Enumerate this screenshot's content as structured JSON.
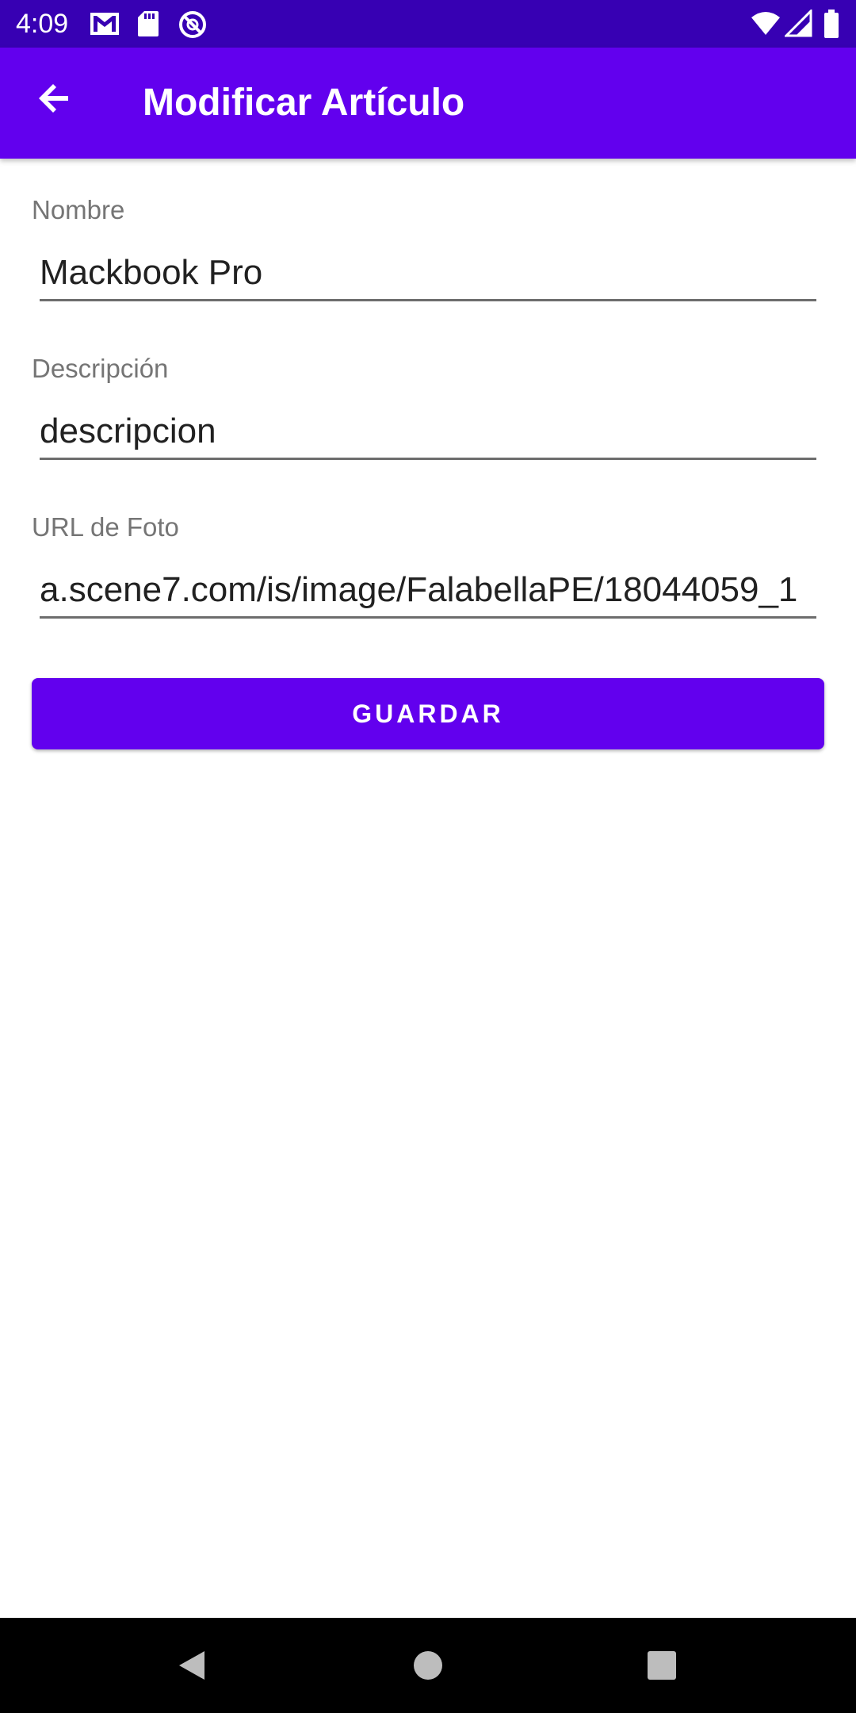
{
  "status_bar": {
    "time": "4:09",
    "left_icons": [
      "gmail-icon",
      "sd-card-icon",
      "do-not-disturb-icon"
    ],
    "right_icons": [
      "wifi-icon",
      "signal-icon",
      "battery-icon"
    ]
  },
  "app_bar": {
    "title": "Modificar Artículo",
    "back_icon": "arrow-back-icon",
    "color": "#6200ee",
    "status_color": "#3700b3"
  },
  "form": {
    "nombre": {
      "label": "Nombre",
      "value": "Mackbook Pro"
    },
    "descripcion": {
      "label": "Descripción",
      "value": "descripcion"
    },
    "url_foto": {
      "label": "URL de Foto",
      "value": "a.scene7.com/is/image/FalabellaPE/18044059_1"
    }
  },
  "save_button": {
    "label": "GUARDAR",
    "color": "#6200ee"
  },
  "nav_bar": {
    "back_icon": "nav-back-icon",
    "home_icon": "nav-home-icon",
    "recents_icon": "nav-recents-icon"
  }
}
